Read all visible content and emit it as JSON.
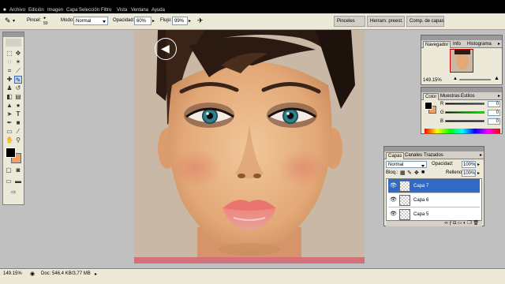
{
  "menu": [
    "Archivo",
    "Edición",
    "Imagen",
    "Capa",
    "Selección",
    "Filtro",
    "Vista",
    "Ventana",
    "Ayuda"
  ],
  "options": {
    "brush_label": "Pincel:",
    "brush_size": "50",
    "mode_label": "Modo:",
    "mode_value": "Normal",
    "opacity_label": "Opacidad:",
    "opacity_value": "60%",
    "flow_label": "Flujo:",
    "flow_value": "99%",
    "well_tabs": [
      "Pinceles",
      "Herram. preest.",
      "Comp. de capas"
    ]
  },
  "navigator": {
    "tabs": [
      "Navegador",
      "Info",
      "Histograma"
    ],
    "zoom": "149.15%"
  },
  "color": {
    "tabs": [
      "Color",
      "Muestras",
      "Estilos"
    ],
    "r_label": "R",
    "g_label": "G",
    "b_label": "B",
    "r": "0",
    "g": "0",
    "b": "0",
    "foreground": "#000000",
    "background": "#f0a060"
  },
  "layers": {
    "tabs": [
      "Capas",
      "Canales",
      "Trazados"
    ],
    "blend_mode": "Normal",
    "opacity_label": "Opacidad:",
    "opacity_value": "100%",
    "lock_label": "Bloq.:",
    "fill_label": "Relleno:",
    "fill_value": "100%",
    "items": [
      "Capa 7",
      "Capa 6",
      "Capa 5"
    ],
    "selected": "Capa 7"
  },
  "status": {
    "zoom": "149.15%",
    "doc": "Doc: 546,4 KB/3,77 MB"
  },
  "accent": "#3169c6"
}
